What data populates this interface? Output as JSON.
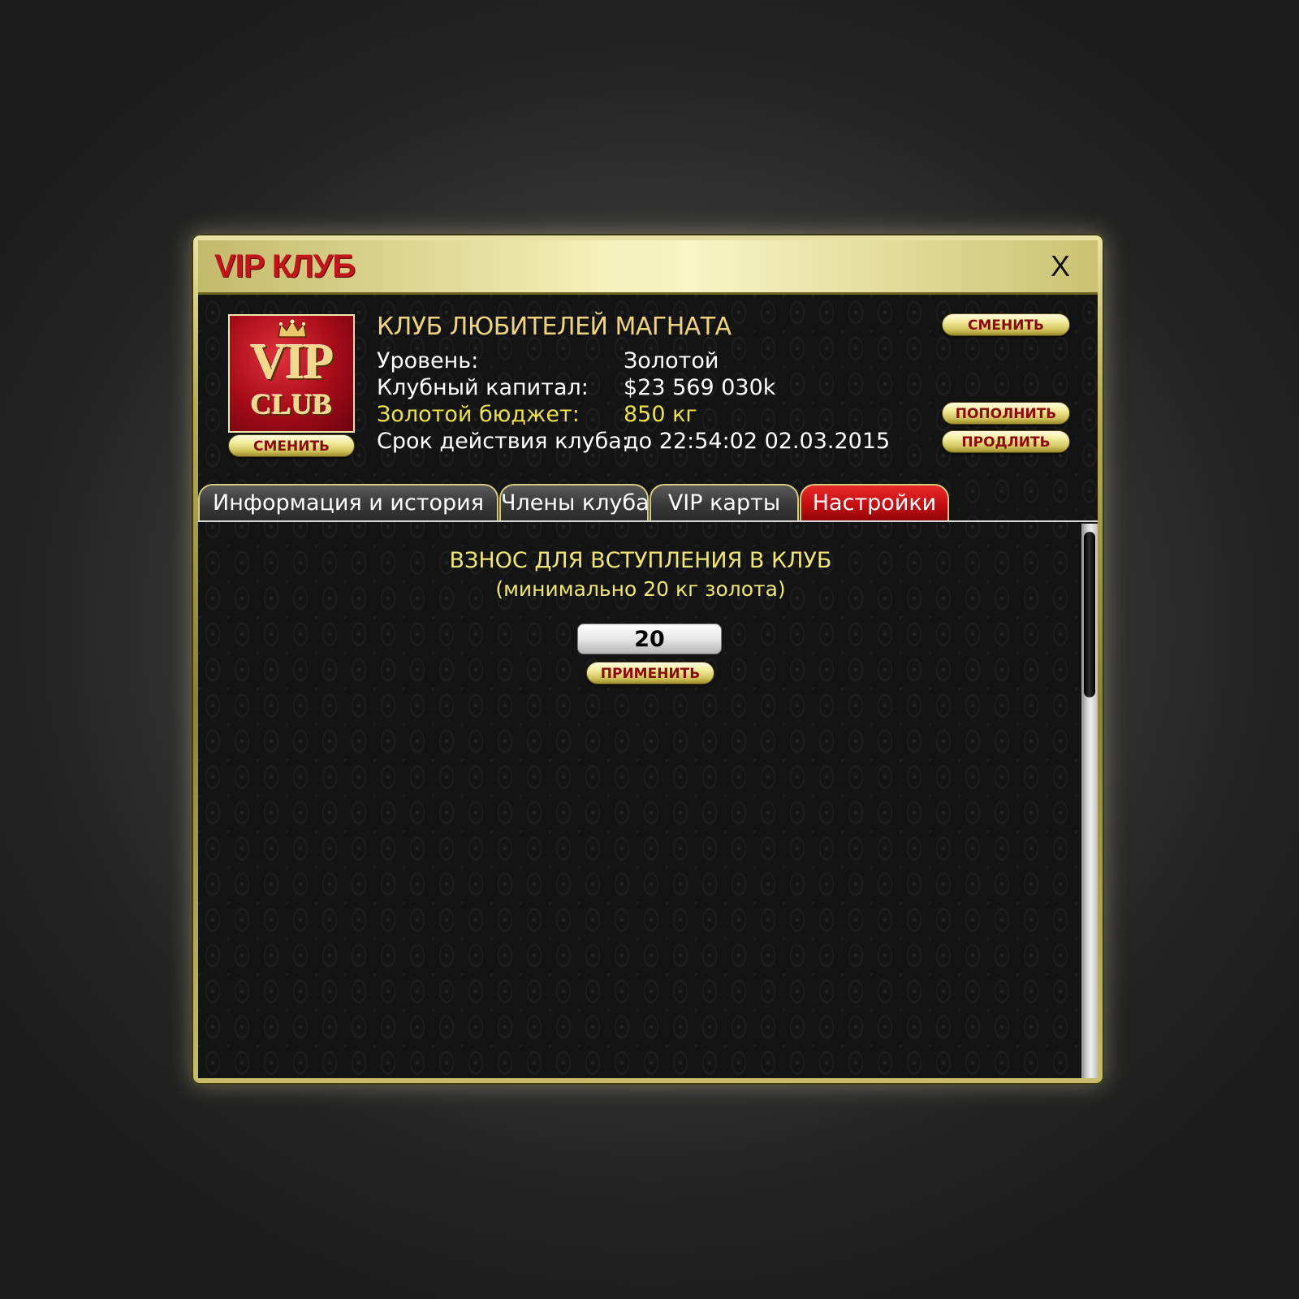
{
  "window": {
    "title": "VIP КЛУБ",
    "close_label": "X"
  },
  "logo": {
    "line1": "VIP",
    "line2": "CLUB",
    "change_label": "СМЕНИТЬ"
  },
  "club": {
    "name": "КЛУБ ЛЮБИТЕЛЕЙ МАГНАТА",
    "fields": [
      {
        "label": "Уровень:",
        "value": "Золотой"
      },
      {
        "label": "Клубный капитал:",
        "value": "$23 569 030k"
      },
      {
        "label": "Золотой бюджет:",
        "value": "850 кг"
      },
      {
        "label": "Срок действия клуба:",
        "value": "до 22:54:02 02.03.2015"
      }
    ]
  },
  "actions": {
    "change_name": "СМЕНИТЬ",
    "top_up": "ПОПОЛНИТЬ",
    "extend": "ПРОДЛИТЬ"
  },
  "tabs": [
    {
      "label": "Информация и история",
      "active": false
    },
    {
      "label": "Члены клуба",
      "active": false
    },
    {
      "label": "VIP карты",
      "active": false
    },
    {
      "label": "Настройки",
      "active": true
    }
  ],
  "settings": {
    "fee_title": "ВЗНОС ДЛЯ ВСТУПЛЕНИЯ В КЛУБ",
    "fee_subtitle": "(минимально 20 кг золота)",
    "fee_value": "20",
    "apply_label": "ПРИМЕНИТЬ"
  },
  "colors": {
    "title_red": "#c0151b",
    "gold_text": "#efd37e",
    "budget_yellow": "#ece14a",
    "active_tab_red": "#c40d12"
  }
}
